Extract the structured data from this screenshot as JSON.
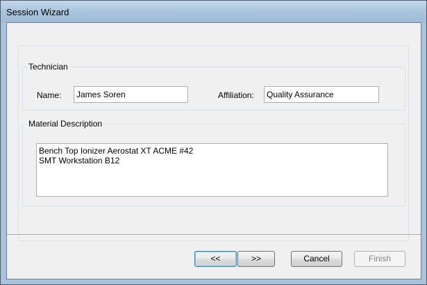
{
  "window": {
    "title": "Session Wizard"
  },
  "technician": {
    "legend": "Technician",
    "name_label": "Name:",
    "name_value": "James Soren",
    "affiliation_label": "Affiliation:",
    "affiliation_value": "Quality Assurance"
  },
  "material": {
    "legend": "Material Description",
    "value": "Bench Top Ionizer Aerostat XT ACME #42\nSMT Workstation B12"
  },
  "buttons": {
    "back": "<<",
    "next": ">>",
    "cancel": "Cancel",
    "finish": "Finish"
  }
}
